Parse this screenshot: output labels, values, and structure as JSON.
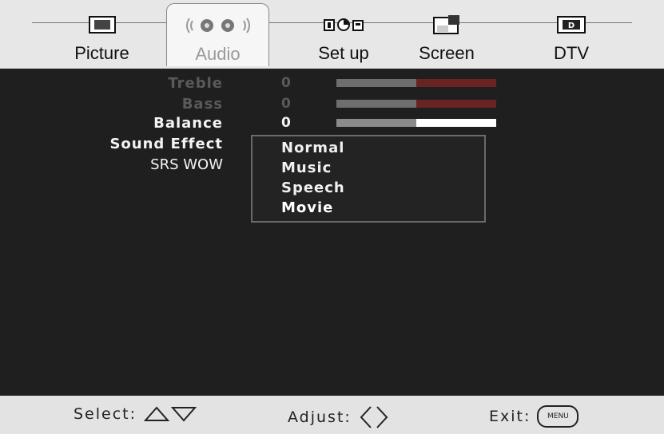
{
  "tabs": [
    {
      "label": "Picture",
      "icon": "tv-monitor-icon"
    },
    {
      "label": "Audio",
      "icon": "speaker-waves-icon"
    },
    {
      "label": "Set up",
      "icon": "setup-devices-icon"
    },
    {
      "label": "Screen",
      "icon": "screen-layout-icon"
    },
    {
      "label": "DTV",
      "icon": "dtv-icon"
    }
  ],
  "dtv_icon_text": "D",
  "settings": [
    {
      "label": "Treble",
      "value": "0",
      "level": 0.5
    },
    {
      "label": "Bass",
      "value": "0",
      "level": 0.5
    },
    {
      "label": "Balance",
      "value": "0",
      "level": 0.5
    },
    {
      "label": "Sound Effect"
    },
    {
      "label": "SRS WOW"
    }
  ],
  "sound_effect_options": [
    "Normal",
    "Music",
    "Speech",
    "Movie"
  ],
  "hints": {
    "select": "Select:",
    "adjust": "Adjust:",
    "exit": "Exit:",
    "menu_button": "MENU"
  }
}
